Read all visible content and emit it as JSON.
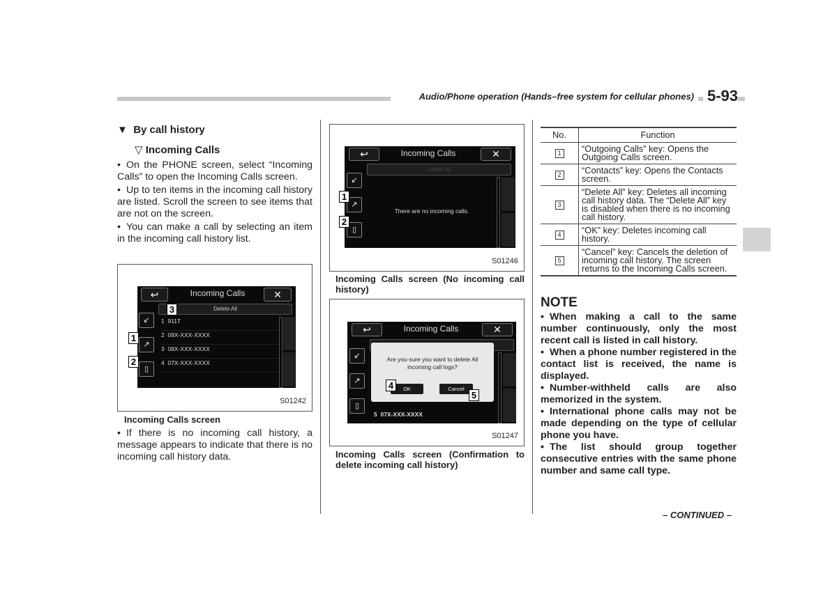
{
  "header": {
    "title": "Audio/Phone operation (Hands–free system for cellular phones)",
    "page_number": "5-93"
  },
  "left": {
    "heading": "By call history",
    "subheading": "Incoming Calls",
    "bullets": [
      "On the PHONE screen, select “Incoming Calls” to open the Incoming Calls screen.",
      "Up to ten items in the incoming call history are listed. Scroll the screen to see items that are not on the screen.",
      "You can make a call by selecting an item in the incoming call history list."
    ],
    "figure": {
      "screen_title": "Incoming Calls",
      "delete_all": "Delete All",
      "rows": [
        {
          "num": "1",
          "value": "911T"
        },
        {
          "num": "2",
          "value": "09X-XXX-XXXX"
        },
        {
          "num": "3",
          "value": "08X-XXX-XXXX"
        },
        {
          "num": "4",
          "value": "07X-XXX-XXXX"
        }
      ],
      "callouts": [
        "1",
        "2",
        "3"
      ],
      "id": "S01242",
      "caption": "Incoming Calls screen"
    },
    "bullet_after": "If there is no incoming call history, a message appears to indicate that there is no incoming call history data."
  },
  "middle": {
    "figure1": {
      "screen_title": "Incoming Calls",
      "delete_all": "Delete All",
      "message": "There are no incoming calls.",
      "callouts": [
        "1",
        "2"
      ],
      "id": "S01246",
      "caption": "Incoming Calls screen (No incoming call history)"
    },
    "figure2": {
      "screen_title": "Incoming Calls",
      "delete_all": "Delete All",
      "dialog_text_line1": "Are you sure you want to delete All",
      "dialog_text_line2": "incoming call logs?",
      "ok": "OK",
      "cancel": "Cancel",
      "bottom_row": {
        "num": "5",
        "value": "07X-XXX-XXXX"
      },
      "callouts": [
        "4",
        "5"
      ],
      "id": "S01247",
      "caption": "Incoming Calls screen (Confirmation to delete incoming call history)"
    }
  },
  "right": {
    "table": {
      "headers": [
        "No.",
        "Function"
      ],
      "rows": [
        {
          "no": "1",
          "function": "“Outgoing Calls” key: Opens the Outgoing Calls screen."
        },
        {
          "no": "2",
          "function": "“Contacts” key: Opens the Contacts screen."
        },
        {
          "no": "3",
          "function": "“Delete All” key: Deletes all incoming call history data. The “Delete All” key is disabled when there is no incoming call history."
        },
        {
          "no": "4",
          "function": "“OK” key: Deletes incoming call history."
        },
        {
          "no": "5",
          "function": "“Cancel” key: Cancels the deletion of incoming call history. The screen returns to the Incoming Calls screen."
        }
      ]
    },
    "note_title": "NOTE",
    "notes": [
      "When making a call to the same number continuously, only the most recent call is listed in call history.",
      "When a phone number registered in the contact list is received, the name is displayed.",
      "Number-withheld calls are also memorized in the system.",
      "International phone calls may not be made depending on the type of cellular phone you have.",
      "The list should group together consecutive entries with the same phone number and same call type."
    ],
    "continued": "– CONTINUED –"
  }
}
